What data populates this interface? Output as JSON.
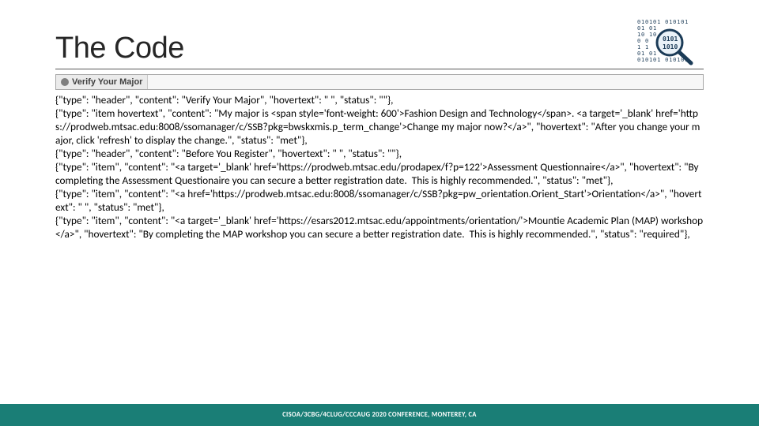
{
  "title": "The Code",
  "header_strip_label": "Verify Your Major",
  "icon_name": "binary-magnifier-icon",
  "code_lines": [
    "{\"type\": \"header\", \"content\": \"Verify Your Major\", \"hovertext\": \" \", \"status\": \"\"},",
    "{\"type\": \"item hovertext\", \"content\": \"My major is <span style='font-weight: 600'>Fashion Design and Technology</span>. <a target='_blank' href='https://prodweb.mtsac.edu:8008/ssomanager/c/SSB?pkg=bwskxmis.p_term_change'>Change my major now?</a>\", \"hovertext\": \"After you change your major, click 'refresh' to display the change.\", \"status\": \"met\"},",
    "{\"type\": \"header\", \"content\": \"Before You Register\", \"hovertext\": \" \", \"status\": \"\"},",
    "{\"type\": \"item\", \"content\": \"<a target='_blank' href='https://prodweb.mtsac.edu/prodapex/f?p=122'>Assessment Questionnaire</a>\", \"hovertext\": \"By completing the Assessment Questionaire you can secure a better registration date.  This is highly recommended.\", \"status\": \"met\"},",
    "{\"type\": \"item\", \"content\": \"<a href='https://prodweb.mtsac.edu:8008/ssomanager/c/SSB?pkg=pw_orientation.Orient_Start'>Orientation</a>\", \"hovertext\": \" \", \"status\": \"met\"},",
    "{\"type\": \"item\", \"content\": \"<a target='_blank' href='https://esars2012.mtsac.edu/appointments/orientation/'>Mountie Academic Plan (MAP) workshop</a>\", \"hovertext\": \"By completing the MAP workshop you can secure a better registration date.  This is highly recommended.\", \"status\": \"required\"},"
  ],
  "footer": "CISOA/3CBG/4CLUG/CCCAUG 2020 CONFERENCE, MONTEREY, CA"
}
